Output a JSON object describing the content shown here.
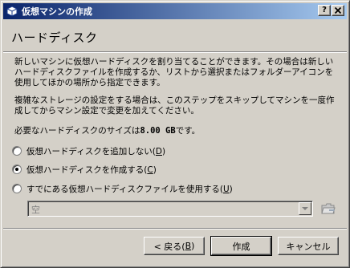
{
  "window": {
    "title": "仮想マシンの作成",
    "help_label": "?",
    "close_label": "X"
  },
  "header": {
    "title": "ハードディスク"
  },
  "content": {
    "paragraph1": "新しいマシンに仮想ハードディスクを割り当てることができます。その場合は新しいハードディスクファイルを作成するか、リストから選択またはフォルダーアイコンを使用してほかの場所から指定できます。",
    "paragraph2": "複雑なストレージの設定をする場合は、このステップをスキップしてマシンを一度作成してからマシン設定で変更を加えてください。",
    "recommended_prefix": "必要なハードディスクのサイズは",
    "recommended_size": "8.00 GB",
    "recommended_suffix": "です。"
  },
  "options": [
    {
      "label": "仮想ハードディスクを追加しない(",
      "mnemonic": "D",
      "close": ")",
      "checked": false
    },
    {
      "label": "仮想ハードディスクを作成する(",
      "mnemonic": "C",
      "close": ")",
      "checked": true
    },
    {
      "label": "すでにある仮想ハードディスクファイルを使用する(",
      "mnemonic": "U",
      "close": ")",
      "checked": false
    }
  ],
  "existing_disk": {
    "value": "空",
    "enabled": false
  },
  "buttons": {
    "back_prefix": "< 戻る(",
    "back_mnemonic": "B",
    "back_suffix": ")",
    "create": "作成",
    "cancel": "キャンセル"
  }
}
